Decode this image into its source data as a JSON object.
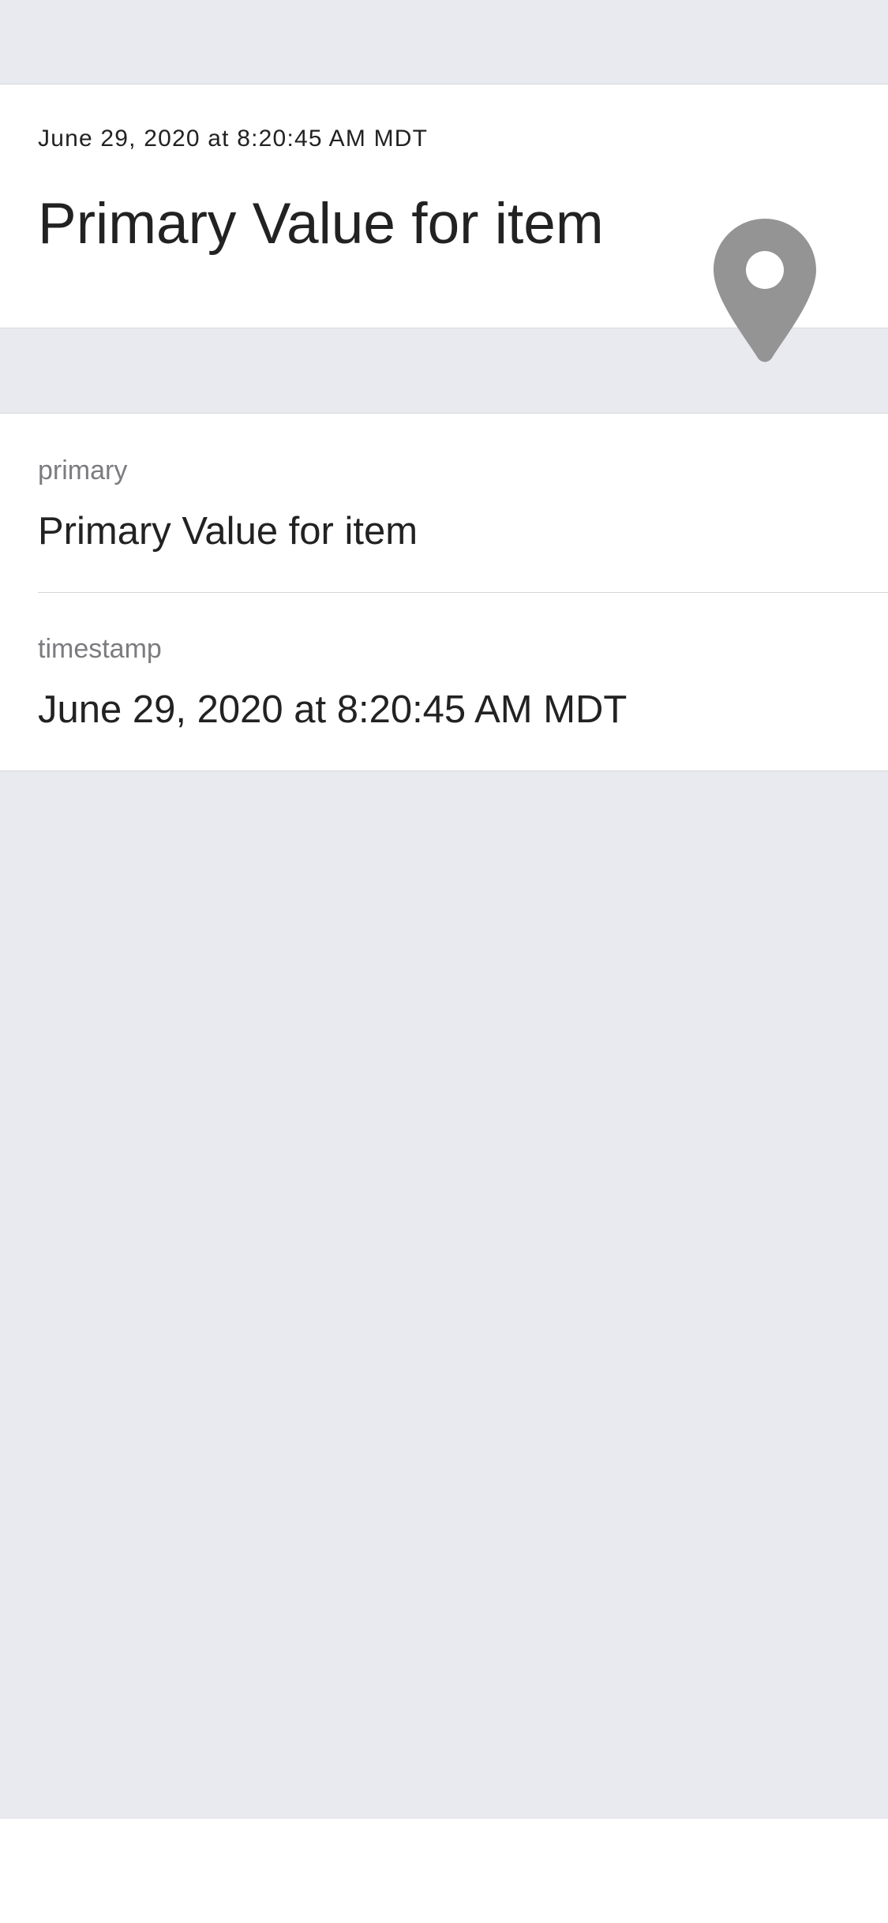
{
  "header": {
    "timestamp": "June 29, 2020 at 8:20:45 AM MDT",
    "title": "Primary Value for item",
    "icon": "map-pin-icon"
  },
  "details": [
    {
      "label": "primary",
      "value": "Primary Value for item"
    },
    {
      "label": "timestamp",
      "value": "June 29, 2020 at 8:20:45 AM MDT"
    }
  ],
  "colors": {
    "background": "#e9eaf0",
    "card": "#ffffff",
    "separator": "#d7d7dc",
    "text_primary": "#222222",
    "text_secondary": "#7b7b80",
    "icon": "#949494"
  }
}
